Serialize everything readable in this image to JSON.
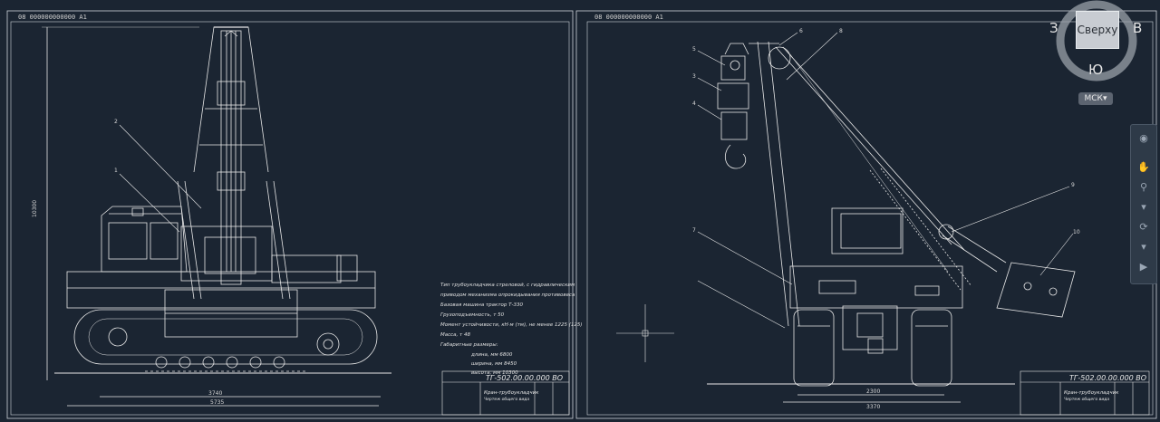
{
  "viewcube": {
    "top_label": "Сверху",
    "west": "З",
    "east": "В",
    "south": "Ю",
    "wcs_label": "МСК"
  },
  "sheet_left": {
    "frame_tag": "08 000000000000 А1",
    "notes": [
      "Тип трубоукладчика        стреловой, с гидравлическим",
      "приводом механизма опрокидывания противовеса",
      "Базовая машина                              трактор  Т-330",
      "Грузоподъемность, т  50",
      "Момент устойчивости, кН·м (тм), не менее  1225 (125)",
      "Масса, т                                                 48",
      "Габаритные размеры:",
      "длина, мм                                 6800",
      "ширина, мм                                8450",
      "высота, мм                               10300"
    ],
    "dim_height": "10300",
    "dim_track": "3740",
    "dim_total": "5735",
    "title_code": "ТГ-502.00.00.000 ВО",
    "title_name": "Кран-трубоукладчик",
    "title_sub": "Чертеж общего вида",
    "leaders": [
      "2",
      "1"
    ]
  },
  "sheet_right": {
    "frame_tag": "08 000000000000 А1",
    "dim_inner": "2300",
    "dim_outer": "3370",
    "title_code": "ТГ-502.00.00.000 ВО",
    "title_name": "Кран-трубоукладчик",
    "title_sub": "Чертеж общего вида",
    "leaders": [
      "5",
      "3",
      "4",
      "6",
      "8",
      "7",
      "9",
      "10"
    ]
  }
}
